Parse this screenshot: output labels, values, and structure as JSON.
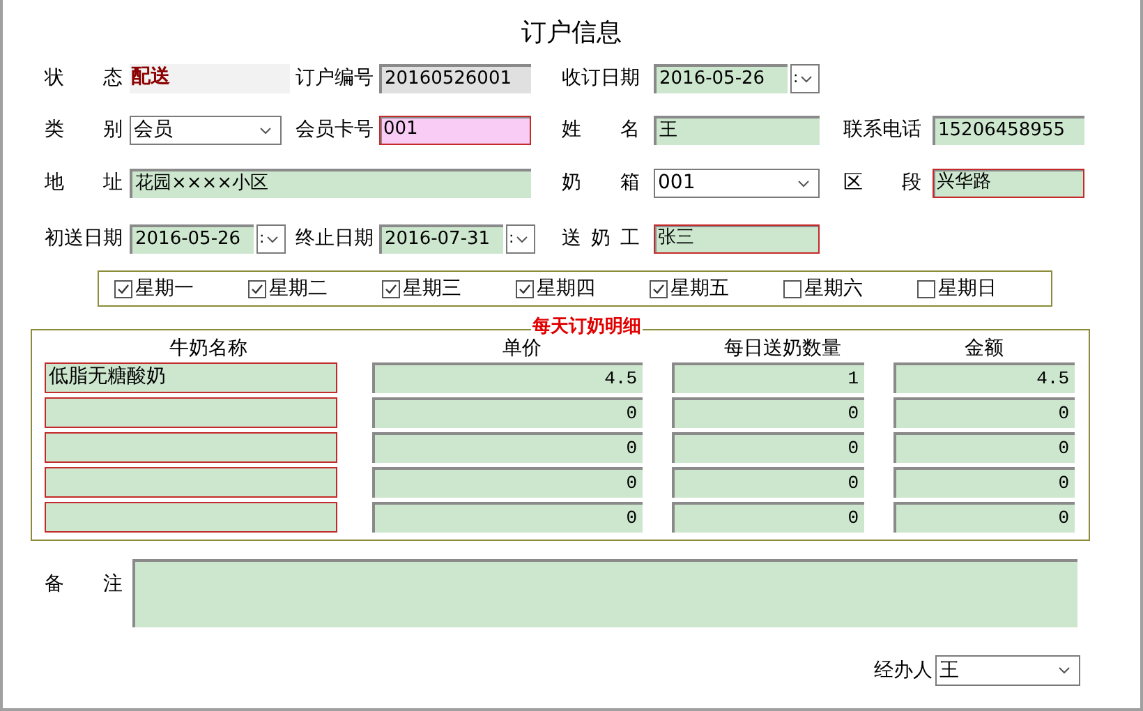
{
  "title": "订户信息",
  "rows": [
    {
      "items": [
        {
          "label": "状 态",
          "kind": "status",
          "value": "配送"
        },
        {
          "label": "订户编号",
          "kind": "text",
          "value": "20160526001",
          "readonly": true,
          "required": false
        },
        {
          "label": "收订日期",
          "kind": "date",
          "value": "2016-05-26",
          "button_text": ":"
        }
      ]
    },
    {
      "items": [
        {
          "label": "类 别",
          "kind": "select",
          "value": "会员"
        },
        {
          "label": "会员卡号",
          "kind": "text",
          "value": "001",
          "required": true,
          "focused": true
        },
        {
          "label": "姓 名",
          "kind": "text",
          "value": "王",
          "required": false
        },
        {
          "label": "联系电话",
          "kind": "text",
          "value": "15206458955",
          "required": false
        }
      ]
    },
    {
      "items": [
        {
          "label": "地 址",
          "kind": "text",
          "value": "花园××××小区",
          "required": false
        },
        {
          "label": "奶 箱",
          "kind": "select",
          "value": "001"
        },
        {
          "label": "区 段",
          "kind": "text",
          "value": "兴华路",
          "required": true
        }
      ]
    },
    {
      "items": [
        {
          "label": "初送日期",
          "kind": "date",
          "value": "2016-05-26",
          "button_text": ":"
        },
        {
          "label": "终止日期",
          "kind": "date",
          "value": "2016-07-31",
          "button_text": ":"
        },
        {
          "label": "送 奶 工",
          "kind": "text",
          "value": "张三",
          "required": true
        }
      ]
    }
  ],
  "weekdays": [
    {
      "label": "星期一",
      "checked": true
    },
    {
      "label": "星期二",
      "checked": true
    },
    {
      "label": "星期三",
      "checked": true
    },
    {
      "label": "星期四",
      "checked": true
    },
    {
      "label": "星期五",
      "checked": true
    },
    {
      "label": "星期六",
      "checked": false
    },
    {
      "label": "星期日",
      "checked": false
    }
  ],
  "detail": {
    "title": "每天订奶明细",
    "columns": [
      "牛奶名称",
      "单价",
      "每日送奶数量",
      "金额"
    ],
    "rows": [
      {
        "name": "低脂无糖酸奶",
        "price": "4.5",
        "quantity": "1",
        "amount": "4.5"
      },
      {
        "price": "0",
        "quantity": "0",
        "amount": "0"
      },
      {
        "price": "0",
        "quantity": "0",
        "amount": "0"
      },
      {
        "price": "0",
        "quantity": "0",
        "amount": "0"
      },
      {
        "price": "0",
        "quantity": "0",
        "amount": "0"
      }
    ]
  },
  "remarks": {
    "label": "备 注"
  },
  "handler": {
    "label": "经办人",
    "value": "王"
  }
}
